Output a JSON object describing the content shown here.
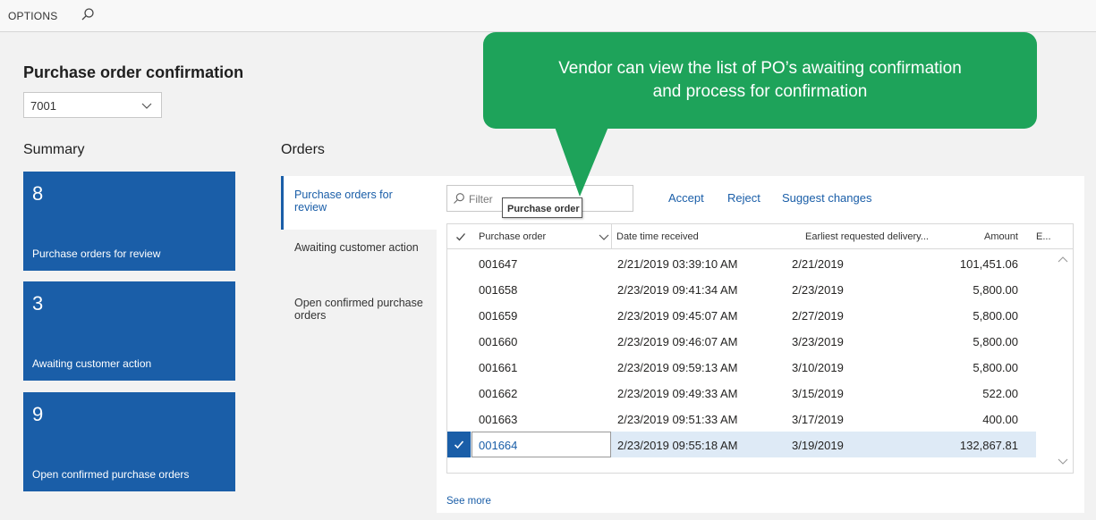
{
  "topbar": {
    "options_label": "OPTIONS",
    "search_icon": "search-icon"
  },
  "page": {
    "title": "Purchase order confirmation",
    "vendor_value": "7001"
  },
  "summary": {
    "title": "Summary",
    "tiles": [
      {
        "count": "8",
        "label": "Purchase orders for review"
      },
      {
        "count": "3",
        "label": "Awaiting customer action"
      },
      {
        "count": "9",
        "label": "Open confirmed purchase orders"
      }
    ],
    "tile_color": "#1a5ea8"
  },
  "orders": {
    "title": "Orders",
    "tabs": [
      {
        "label": "Purchase orders for review",
        "active": true
      },
      {
        "label": "Awaiting customer action",
        "active": false
      },
      {
        "label": "Open confirmed purchase orders",
        "active": false
      }
    ],
    "filter_placeholder": "Filter",
    "tooltip": "Purchase order",
    "actions": [
      "Accept",
      "Reject",
      "Suggest changes"
    ],
    "columns": [
      "Purchase order",
      "Date time received",
      "Earliest requested delivery...",
      "Amount",
      "E..."
    ],
    "rows": [
      {
        "po": "001647",
        "received": "2/21/2019 03:39:10 AM",
        "delivery": "2/21/2019",
        "amount": "101,451.06"
      },
      {
        "po": "001658",
        "received": "2/23/2019 09:41:34 AM",
        "delivery": "2/23/2019",
        "amount": "5,800.00"
      },
      {
        "po": "001659",
        "received": "2/23/2019 09:45:07 AM",
        "delivery": "2/27/2019",
        "amount": "5,800.00"
      },
      {
        "po": "001660",
        "received": "2/23/2019 09:46:07 AM",
        "delivery": "3/23/2019",
        "amount": "5,800.00"
      },
      {
        "po": "001661",
        "received": "2/23/2019 09:59:13 AM",
        "delivery": "3/10/2019",
        "amount": "5,800.00"
      },
      {
        "po": "001662",
        "received": "2/23/2019 09:49:33 AM",
        "delivery": "3/15/2019",
        "amount": "522.00"
      },
      {
        "po": "001663",
        "received": "2/23/2019 09:51:33 AM",
        "delivery": "3/17/2019",
        "amount": "400.00"
      },
      {
        "po": "001664",
        "received": "2/23/2019 09:55:18 AM",
        "delivery": "3/19/2019",
        "amount": "132,867.81",
        "selected": true
      }
    ],
    "see_more": "See more"
  },
  "callout": {
    "line1": "Vendor can view the list of PO’s awaiting confirmation",
    "line2": "and process for confirmation",
    "color": "#1ea35a"
  }
}
